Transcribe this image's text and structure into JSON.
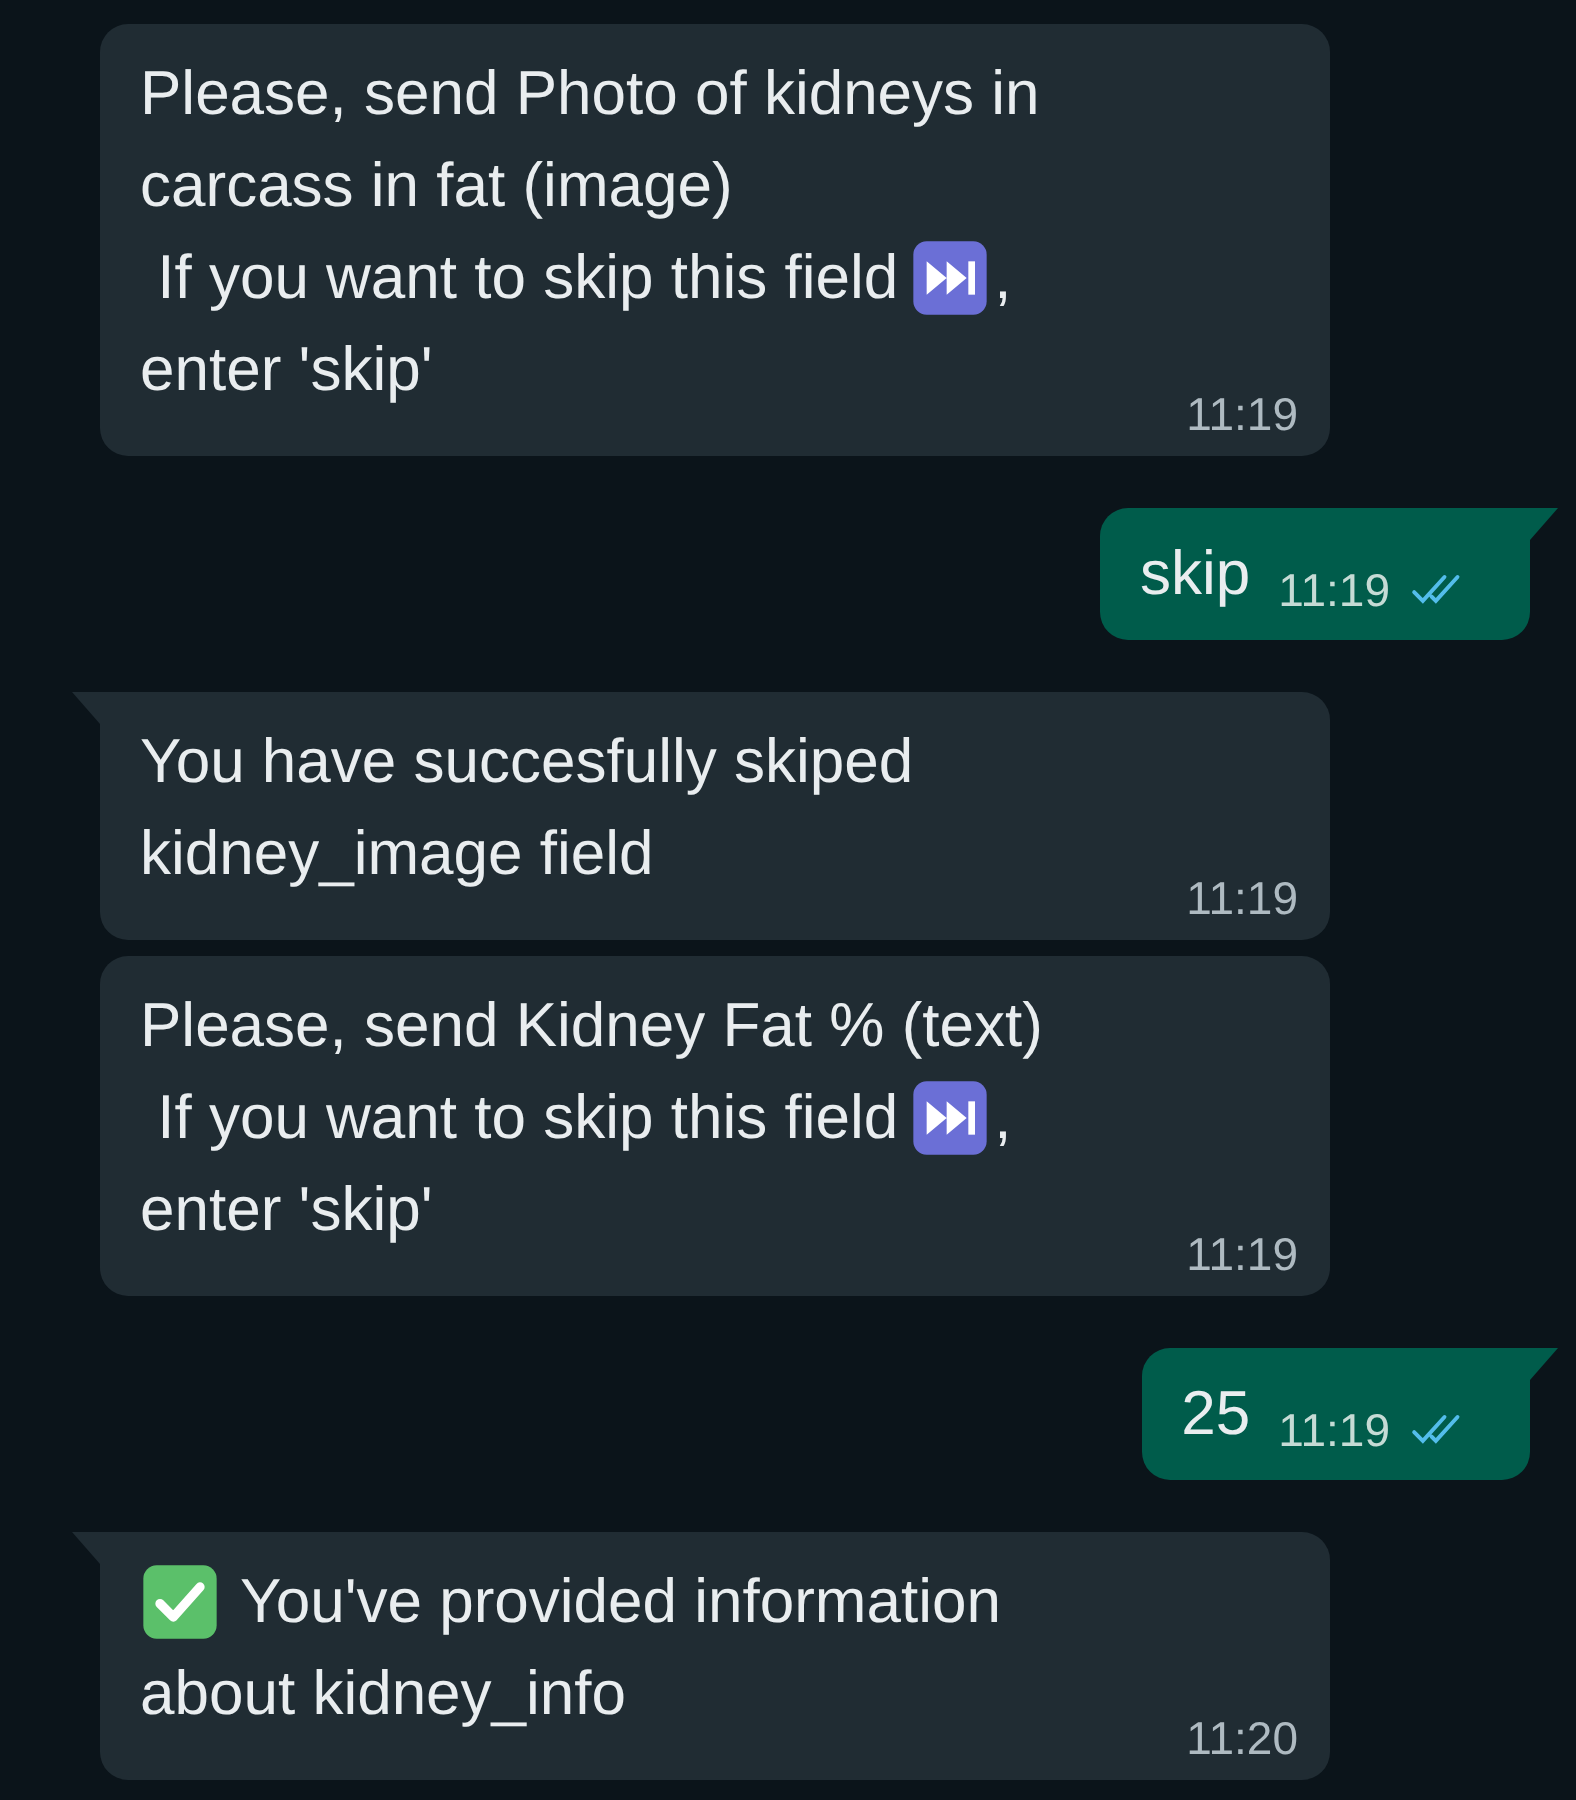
{
  "messages": [
    {
      "kind": "incoming",
      "tail": false,
      "lines": [
        [
          {
            "kind": "text",
            "text": "Please, send Photo of kidneys in"
          }
        ],
        [
          {
            "kind": "text",
            "text": "carcass in fat (image)"
          }
        ],
        [
          {
            "kind": "text",
            "text": " If you want to skip this field"
          },
          {
            "kind": "skip_icon"
          },
          {
            "kind": "text",
            "text": ","
          }
        ],
        [
          {
            "kind": "text",
            "text": "enter 'skip'"
          }
        ]
      ],
      "time": "11:19"
    },
    {
      "kind": "outgoing",
      "tail": true,
      "read": true,
      "lines": [
        [
          {
            "kind": "text",
            "text": "skip"
          }
        ]
      ],
      "time": "11:19"
    },
    {
      "kind": "incoming",
      "tail": true,
      "lines": [
        [
          {
            "kind": "text",
            "text": "You have succesfully skiped"
          }
        ],
        [
          {
            "kind": "text",
            "text": "kidney_image field"
          }
        ]
      ],
      "time": "11:19"
    },
    {
      "kind": "incoming",
      "tail": false,
      "lines": [
        [
          {
            "kind": "text",
            "text": "Please, send Kidney Fat % (text)"
          }
        ],
        [
          {
            "kind": "text",
            "text": " If you want to skip this field"
          },
          {
            "kind": "skip_icon"
          },
          {
            "kind": "text",
            "text": ","
          }
        ],
        [
          {
            "kind": "text",
            "text": "enter 'skip'"
          }
        ]
      ],
      "time": "11:19"
    },
    {
      "kind": "outgoing",
      "tail": true,
      "read": true,
      "lines": [
        [
          {
            "kind": "text",
            "text": "25"
          }
        ]
      ],
      "time": "11:19"
    },
    {
      "kind": "incoming",
      "tail": true,
      "lines": [
        [
          {
            "kind": "check_icon"
          },
          {
            "kind": "text",
            "text": "You've provided information"
          }
        ],
        [
          {
            "kind": "text",
            "text": "about kidney_info"
          }
        ]
      ],
      "time": "11:20"
    }
  ]
}
